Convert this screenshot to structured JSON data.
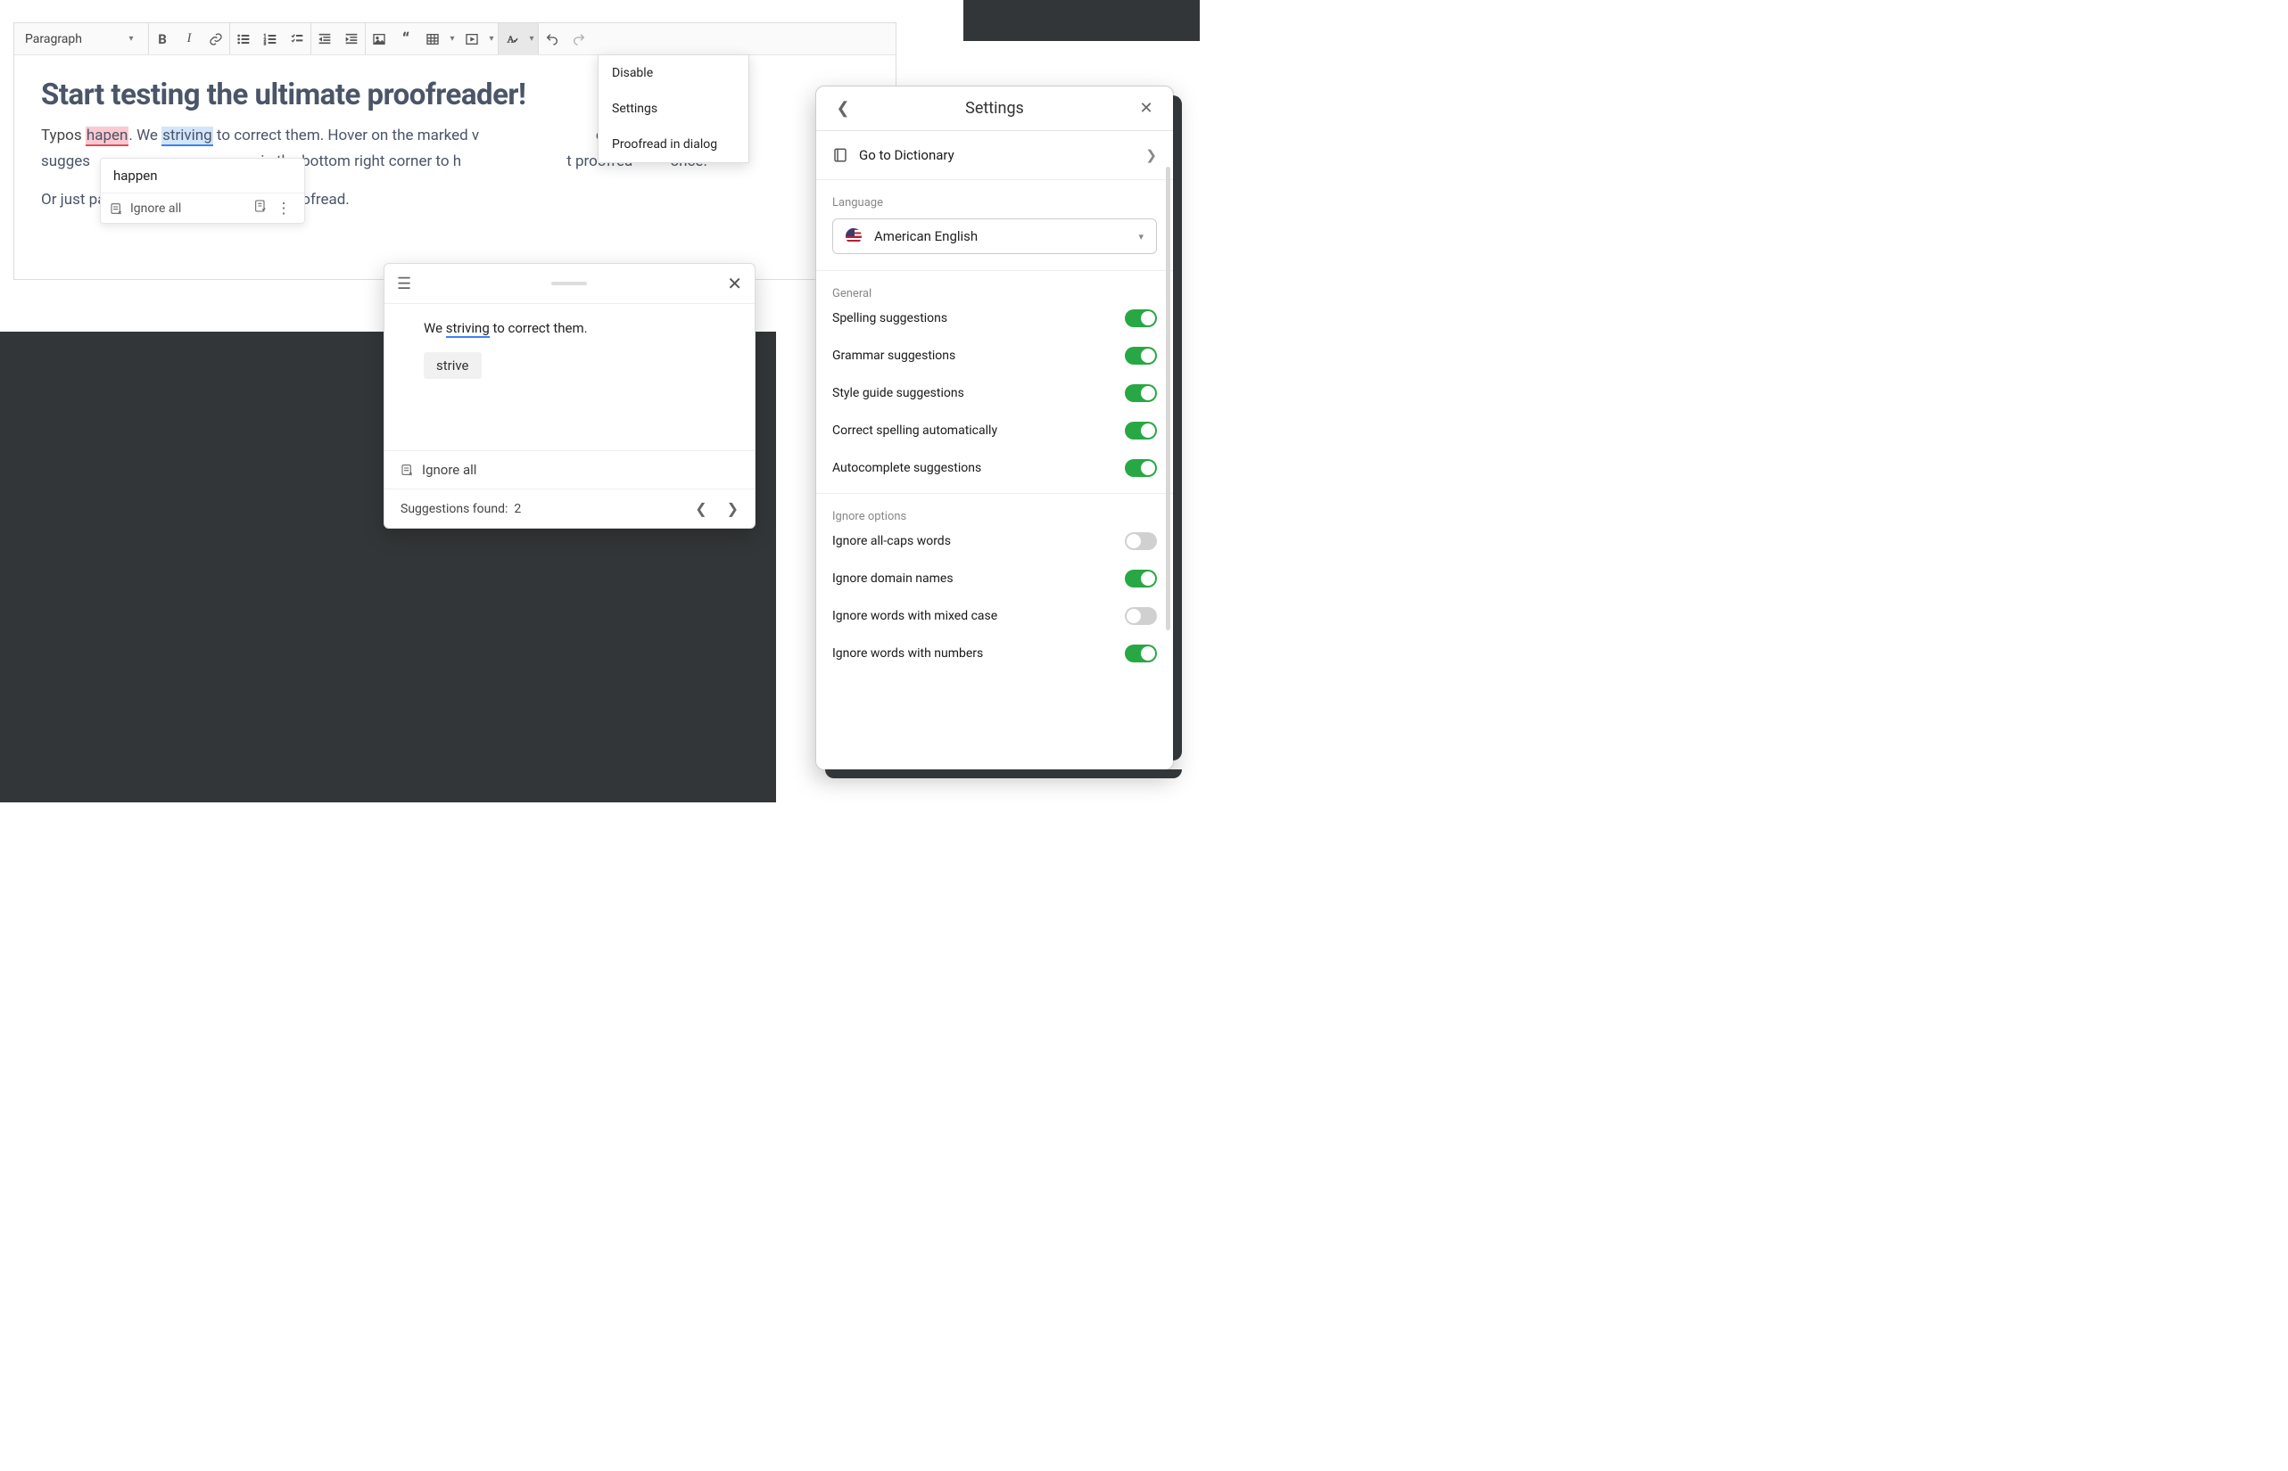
{
  "toolbar": {
    "block_format": "Paragraph"
  },
  "proofread_menu": {
    "items": [
      "Disable",
      "Settings",
      "Proofread in dialog"
    ]
  },
  "document": {
    "heading": "Start testing the ultimate proofreader!",
    "p1_pre": "Typos ",
    "p1_err1": "hapen",
    "p1_mid1": ". We ",
    "p1_err2": "striving",
    "p1_mid2": " to correct them. Hover on the marked v",
    "p1_mid3": "orrection sugges",
    "p1_mid4": "cn in the bottom right corner to h",
    "p1_mid5": "t proofrea",
    "p1_end": "once.",
    "p2": "Or just paste your own text to get it proofread."
  },
  "inline_card": {
    "suggestion": "happen",
    "ignore_label": "Ignore all"
  },
  "dialog": {
    "sentence_pre": "We ",
    "sentence_err": "striving",
    "sentence_post": " to correct them.",
    "chip": "strive",
    "ignore_label": "Ignore all",
    "footer_label": "Suggestions found:",
    "footer_count": "2"
  },
  "settings": {
    "title": "Settings",
    "go_dictionary": "Go to Dictionary",
    "language_label": "Language",
    "language_value": "American English",
    "general_label": "General",
    "general_opts": [
      {
        "label": "Spelling suggestions",
        "on": true
      },
      {
        "label": "Grammar suggestions",
        "on": true
      },
      {
        "label": "Style guide suggestions",
        "on": true
      },
      {
        "label": "Correct spelling automatically",
        "on": true
      },
      {
        "label": "Autocomplete suggestions",
        "on": true
      }
    ],
    "ignore_label": "Ignore options",
    "ignore_opts": [
      {
        "label": "Ignore all-caps words",
        "on": false
      },
      {
        "label": "Ignore domain names",
        "on": true
      },
      {
        "label": "Ignore words with mixed case",
        "on": false
      },
      {
        "label": "Ignore words with numbers",
        "on": true
      }
    ]
  }
}
